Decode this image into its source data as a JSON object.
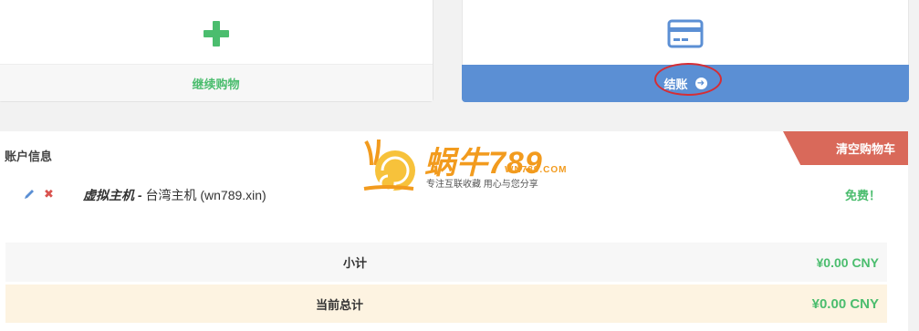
{
  "top_actions": {
    "continue_shopping": {
      "label": "继续购物",
      "icon": "plus-icon"
    },
    "checkout": {
      "label": "结账",
      "icon": "credit-card-icon",
      "arrow_icon": "arrow-circle-right-icon"
    }
  },
  "account": {
    "title": "账户信息",
    "clear_cart_label": "清空购物车"
  },
  "cart_item": {
    "category": "虚拟主机",
    "separator": " - ",
    "product": "台湾主机",
    "domain": "(wn789.xin)",
    "price": "免费！"
  },
  "totals": {
    "subtotal_label": "小计",
    "subtotal_value": "¥0.00 CNY",
    "total_label": "当前总计",
    "total_value": "¥0.00 CNY"
  },
  "watermark": {
    "name": "蜗牛789",
    "domain": "WN789.COM",
    "slogan": "专注互联收藏   用心与您分享"
  },
  "colors": {
    "accent_green": "#4bbd6e",
    "checkout_blue": "#5b8fd4",
    "clear_red": "#d9695a",
    "annotation_red": "#d62d34"
  }
}
